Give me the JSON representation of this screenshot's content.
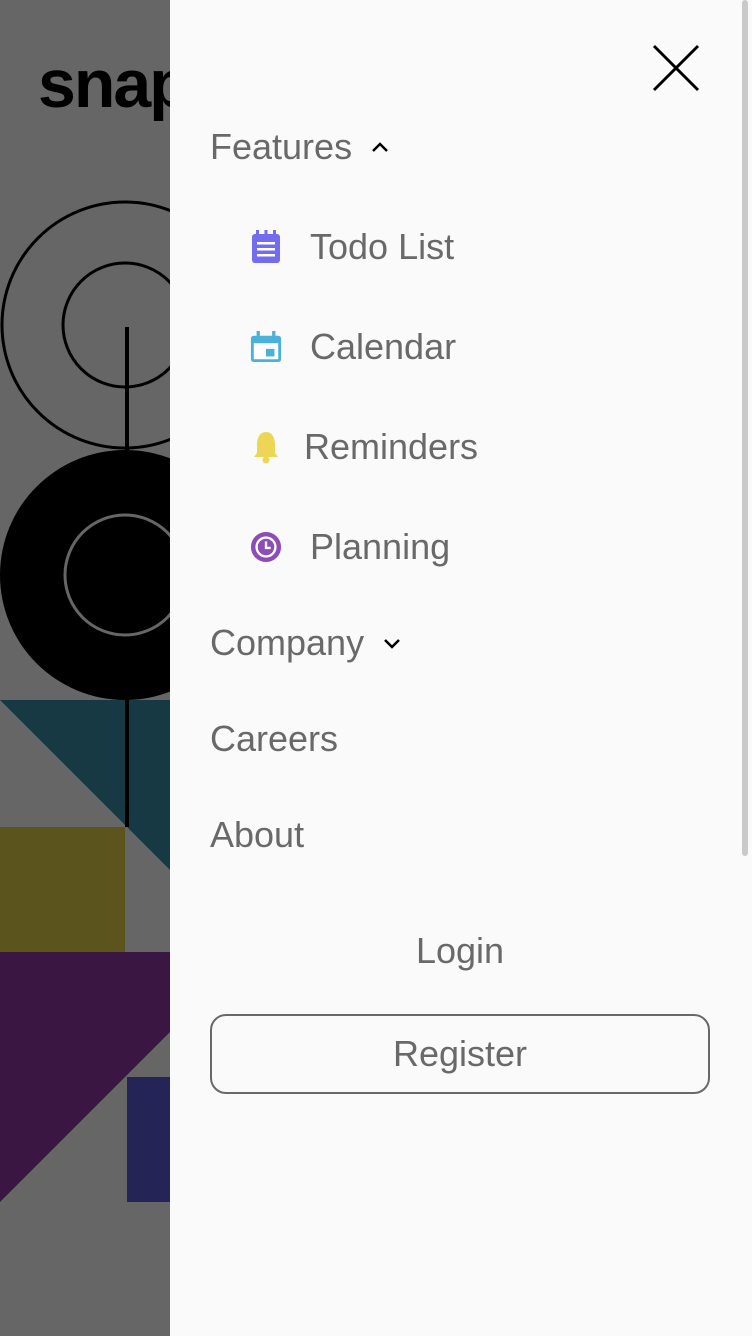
{
  "background": {
    "logo_text": "snap"
  },
  "menu": {
    "features": {
      "label": "Features",
      "expanded": true,
      "items": [
        {
          "label": "Todo List",
          "icon": "todo-list-icon",
          "color": "#726CEE"
        },
        {
          "label": "Calendar",
          "icon": "calendar-icon",
          "color": "#4BB1DA"
        },
        {
          "label": "Reminders",
          "icon": "bell-icon",
          "color": "#EDD556"
        },
        {
          "label": "Planning",
          "icon": "clock-icon",
          "color": "#8E4CB6"
        }
      ]
    },
    "company": {
      "label": "Company",
      "expanded": false
    },
    "careers": {
      "label": "Careers"
    },
    "about": {
      "label": "About"
    }
  },
  "auth": {
    "login_label": "Login",
    "register_label": "Register"
  },
  "colors": {
    "drawer_bg": "#FAFAFA",
    "text": "#696969",
    "overlay": "rgba(0,0,0,0.6)"
  }
}
